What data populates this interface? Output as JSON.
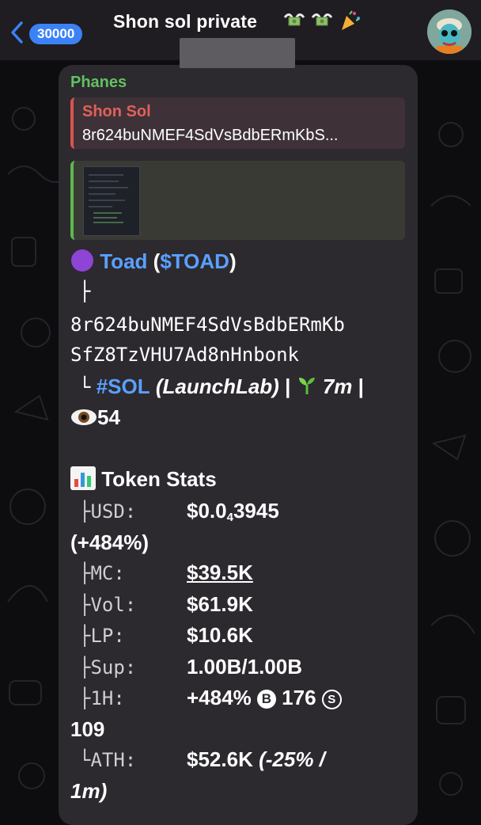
{
  "header": {
    "back_count": "30000",
    "title": "Shon sol private"
  },
  "message": {
    "sender": "Phanes",
    "reply": {
      "name": "Shon Sol",
      "text": "8r624buNMEF4SdVsBdbERmKbS..."
    },
    "token": {
      "name": "Toad",
      "ticker_open": " (",
      "ticker": "$TOAD",
      "ticker_close": ")",
      "tree_top": "├",
      "address_line1": "8r624buNMEF4SdVsBdbERmKb",
      "address_line2": "SfZ8TzVHU7Ad8nHnbonk",
      "tree_corner": "└",
      "chain": "#SOL",
      "platform": "(LaunchLab)",
      "separator": "|",
      "age": "7m",
      "views": "54"
    },
    "stats": {
      "heading": "Token Stats",
      "usd_label": "├USD:",
      "usd_value_a": "$0.0",
      "usd_value_sub": "4",
      "usd_value_b": "3945",
      "usd_change": "(+484%)",
      "mc_label": "├MC:",
      "mc_value": "$39.5K",
      "vol_label": "├Vol:",
      "vol_value": "$61.9K",
      "lp_label": "├LP:",
      "lp_value": "$10.6K",
      "sup_label": "├Sup:",
      "sup_value": "1.00B/1.00B",
      "h1_label": "├1H:",
      "h1_value": "+484%",
      "h1_buy_icon": "B",
      "h1_buys": "176",
      "h1_sell_icon": "S",
      "h1_sells": "109",
      "ath_label": "└ATH:",
      "ath_value": "$52.6K",
      "ath_change": "(-25% /",
      "ath_time": "1m)"
    }
  },
  "colors": {
    "header_bg": "#1f1c22",
    "bubble_bg": "#2c292f",
    "badge": "#3b82f6",
    "sender": "#63c160",
    "reply_accent": "#d9534f",
    "link": "#5aa0ff"
  },
  "icons": [
    "back-chevron-icon",
    "money-wings-emoji",
    "party-popper-emoji",
    "purple-circle-emoji",
    "seedling-emoji",
    "eye-emoji",
    "bar-chart-emoji",
    "buy-icon",
    "sell-icon"
  ]
}
